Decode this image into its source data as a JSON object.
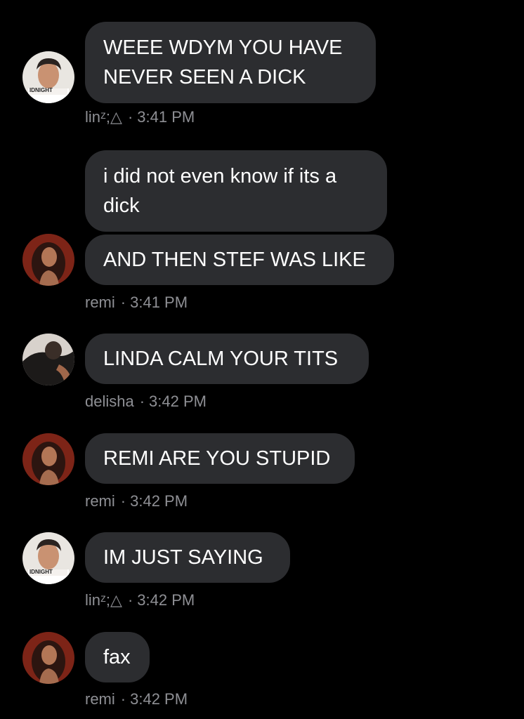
{
  "messages": [
    {
      "sender": "linᶻ;△",
      "time": "3:41 PM",
      "avatar": "lin-avatar-icon",
      "bubbles": [
        "WEEE WDYM YOU HAVE NEVER SEEN A DICK"
      ]
    },
    {
      "sender": "remi",
      "time": "3:41 PM",
      "avatar": "remi-avatar-icon",
      "bubbles": [
        "i did not even know if its a dick",
        "AND THEN STEF WAS LIKE"
      ]
    },
    {
      "sender": "delisha",
      "time": "3:42 PM",
      "avatar": "delisha-avatar-icon",
      "bubbles": [
        "LINDA CALM YOUR TITS"
      ]
    },
    {
      "sender": "remi",
      "time": "3:42 PM",
      "avatar": "remi-avatar-icon",
      "bubbles": [
        "REMI ARE YOU STUPID"
      ]
    },
    {
      "sender": "linᶻ;△",
      "time": "3:42 PM",
      "avatar": "lin-avatar-icon",
      "bubbles": [
        "IM JUST SAYING"
      ]
    },
    {
      "sender": "remi",
      "time": "3:42 PM",
      "avatar": "remi-avatar-icon",
      "bubbles": [
        "fax"
      ]
    }
  ],
  "avatar_badge_text": "IDNIGHT",
  "colors": {
    "background": "#000000",
    "bubble": "#2c2d30",
    "meta_text": "#8e8f94",
    "message_text": "#ffffff"
  }
}
